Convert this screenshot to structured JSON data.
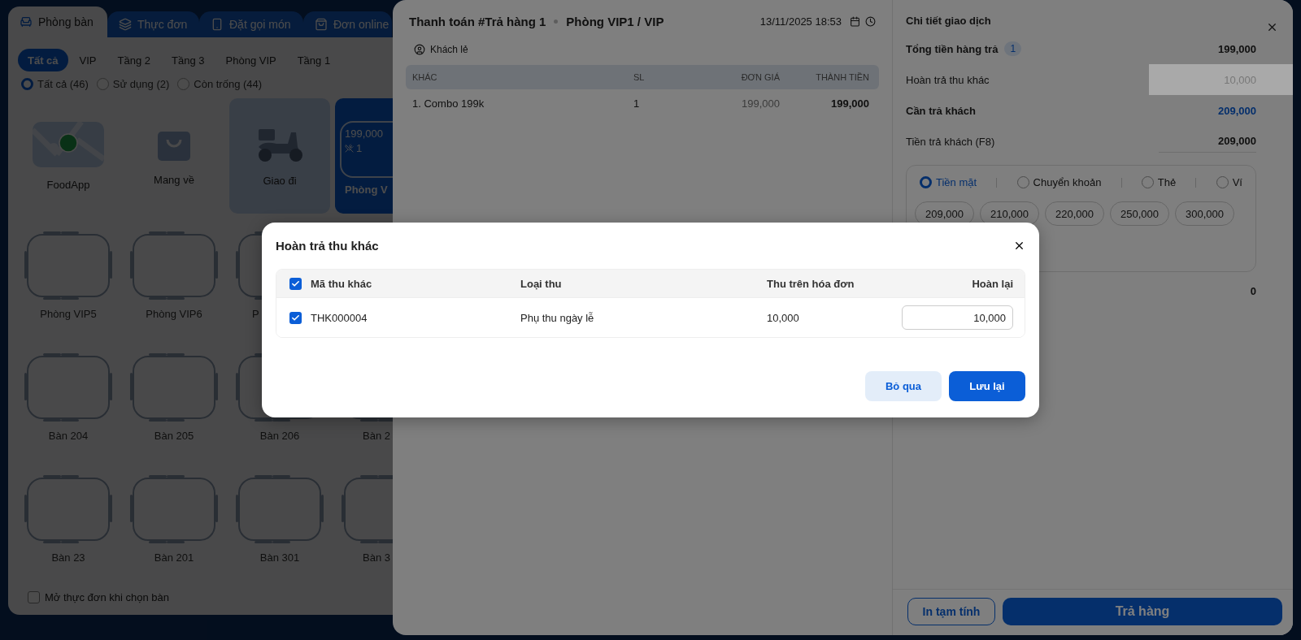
{
  "app_tabs": [
    {
      "label": "Phòng bàn",
      "selected": true
    },
    {
      "label": "Thực đơn",
      "selected": false
    },
    {
      "label": "Đặt gọi món",
      "selected": false
    },
    {
      "label": "Đơn online",
      "selected": false
    }
  ],
  "area_filters": [
    {
      "label": "Tất cả",
      "selected": true
    },
    {
      "label": "VIP",
      "selected": false
    },
    {
      "label": "Tầng 2",
      "selected": false
    },
    {
      "label": "Tầng 3",
      "selected": false
    },
    {
      "label": "Phòng VIP",
      "selected": false
    },
    {
      "label": "Tầng 1",
      "selected": false
    }
  ],
  "status_filters": [
    {
      "label": "Tất cả (46)",
      "selected": true
    },
    {
      "label": "Sử dụng (2)",
      "selected": false
    },
    {
      "label": "Còn trống (44)",
      "selected": false
    }
  ],
  "service_cards": [
    {
      "kind": "foodapp",
      "label": "FoodApp",
      "selected": false
    },
    {
      "kind": "takeaway",
      "label": "Mang về",
      "selected": false
    },
    {
      "kind": "delivery",
      "label": "Giao đi",
      "selected": true
    },
    {
      "kind": "room",
      "label": "Phòng V",
      "amount": "199,000",
      "guests": "1",
      "selected": false
    }
  ],
  "table_rows": [
    [
      {
        "label": "Phòng VIP5"
      },
      {
        "label": "Phòng VIP6"
      },
      {
        "label": "P"
      }
    ],
    [
      {
        "label": "Bàn 204"
      },
      {
        "label": "Bàn 205"
      },
      {
        "label": "Bàn 206"
      },
      {
        "label": "Bàn 2"
      }
    ],
    [
      {
        "label": "Bàn 23"
      },
      {
        "label": "Bàn 201"
      },
      {
        "label": "Bàn 301"
      },
      {
        "label": "Bàn 3"
      }
    ]
  ],
  "open_menu_option": {
    "label": "Mở thực đơn khi chọn bàn",
    "checked": false
  },
  "checkout": {
    "title": "Thanh toán #Trả hàng 1",
    "location": "Phòng VIP1 / VIP",
    "datetime": "13/11/2025 18:53",
    "customer": "Khách lẻ",
    "columns": [
      "KHÁC",
      "SL",
      "ĐƠN GIÁ",
      "THÀNH TIỀN"
    ],
    "items": [
      {
        "name": "1. Combo 199k",
        "qty": "1",
        "price": "199,000",
        "total": "199,000"
      }
    ]
  },
  "details": {
    "title": "Chi tiết giao dịch",
    "rows": [
      {
        "kind": "total",
        "label": "Tổng tiền hàng trả",
        "badge": "1",
        "value": "199,000"
      },
      {
        "kind": "highlight-field",
        "label": "Hoàn trả thu khác",
        "value": "10,000"
      },
      {
        "kind": "due",
        "label": "Cần trả khách",
        "value": "209,000"
      },
      {
        "kind": "field",
        "label": "Tiền trả khách (F8)",
        "value": "209,000"
      }
    ],
    "payment_methods": [
      {
        "label": "Tiền mặt",
        "selected": true
      },
      {
        "label": "Chuyển khoản",
        "selected": false
      },
      {
        "label": "Thẻ",
        "selected": false
      },
      {
        "label": "Ví",
        "selected": false
      }
    ],
    "quick_amounts": [
      "209,000",
      "210,000",
      "220,000",
      "250,000",
      "300,000"
    ],
    "change_value": "0",
    "print_button": "In tạm tính",
    "return_button": "Trả hàng"
  },
  "modal": {
    "title": "Hoàn trả thu khác",
    "select_all_checked": true,
    "columns": [
      "Mã thu khác",
      "Loại thu",
      "Thu trên hóa đơn",
      "Hoàn lại"
    ],
    "rows": [
      {
        "code": "THK000004",
        "type": "Phụ thu ngày lễ",
        "charged": "10,000",
        "refund": "10,000",
        "checked": true
      }
    ],
    "cancel_button": "Bỏ qua",
    "save_button": "Lưu lại"
  }
}
